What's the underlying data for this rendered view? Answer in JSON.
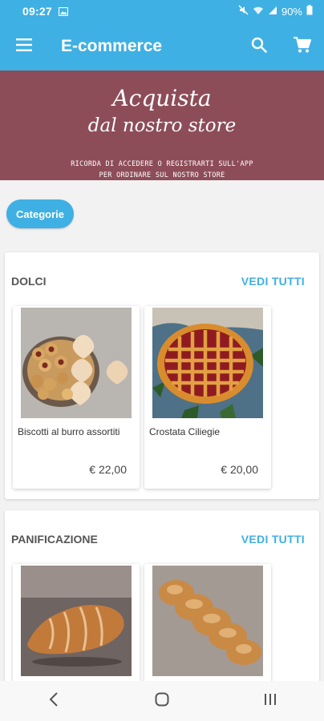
{
  "status_bar": {
    "time": "09:27",
    "battery": "90%"
  },
  "app_bar": {
    "title": "E-commerce"
  },
  "banner": {
    "line1": "Acquista",
    "line2": "dal nostro store",
    "sub1": "RICORDA DI ACCEDERE O REGISTRARTI SULL'APP",
    "sub2": "PER ORDINARE SUL NOSTRO STORE"
  },
  "chip": {
    "label": "Categorie"
  },
  "sections": [
    {
      "title": "DOLCI",
      "see_all": "VEDI TUTTI",
      "products": [
        {
          "name": "Biscotti al burro assortiti",
          "price": "€ 22,00"
        },
        {
          "name": "Crostata Ciliegie",
          "price": "€ 20,00"
        }
      ]
    },
    {
      "title": "PANIFICAZIONE",
      "see_all": "VEDI TUTTI",
      "products": [
        {
          "name": "",
          "price": ""
        },
        {
          "name": "",
          "price": ""
        }
      ]
    }
  ],
  "colors": {
    "primary": "#3fb0e3",
    "banner": "#8d4d58"
  }
}
